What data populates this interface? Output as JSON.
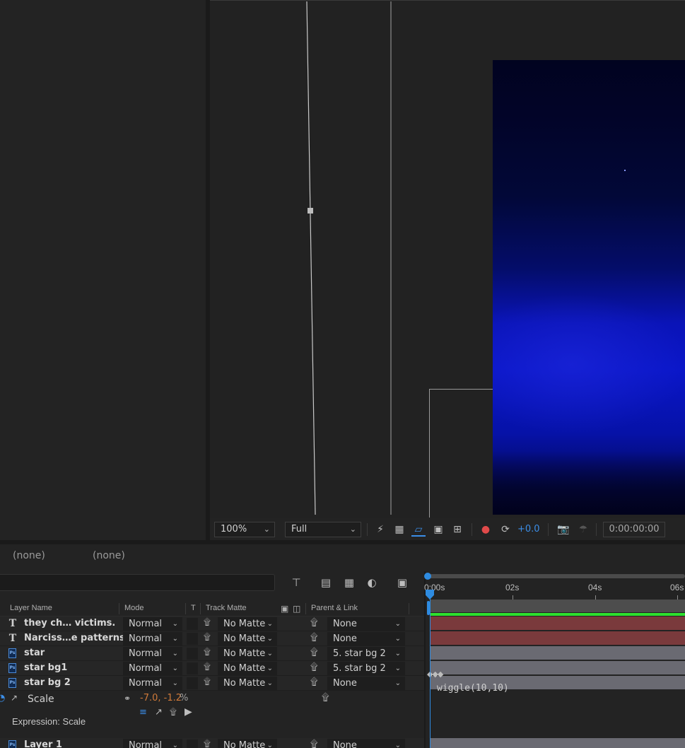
{
  "viewer": {
    "zoom": "100%",
    "resolution": "Full",
    "exposure": "+0.0",
    "timecode": "0:00:00:00",
    "icons": [
      "fast-preview-icon",
      "transparency-grid-icon",
      "mask-path-icon",
      "region-of-interest-icon",
      "safe-margins-icon",
      "color-channels-icon",
      "reset-exposure-icon",
      "snapshot-icon",
      "show-snapshot-icon"
    ]
  },
  "timeline": {
    "flowchart_labels": [
      "(none)",
      "(none)"
    ],
    "columns": {
      "layer_name": "Layer Name",
      "mode": "Mode",
      "t": "T",
      "track_matte": "Track Matte",
      "parent_link": "Parent & Link"
    },
    "layers": [
      {
        "type": "text",
        "name": "they ch… victims.",
        "mode": "Normal",
        "matte": "No Matte",
        "parent": "None",
        "color": "#7a3a3c"
      },
      {
        "type": "text",
        "name": "Narciss…e patterns;",
        "mode": "Normal",
        "matte": "No Matte",
        "parent": "None",
        "color": "#7a3a3c"
      },
      {
        "type": "ps",
        "name": "star",
        "mode": "Normal",
        "matte": "No Matte",
        "parent": "5. star bg 2",
        "color": "#6a6a72"
      },
      {
        "type": "ps",
        "name": "star bg1",
        "mode": "Normal",
        "matte": "No Matte",
        "parent": "5. star bg 2",
        "color": "#6a6a72"
      },
      {
        "type": "ps",
        "name": "star bg 2",
        "mode": "Normal",
        "matte": "No Matte",
        "parent": "None",
        "color": "#6a6a72"
      }
    ],
    "scale": {
      "label": "Scale",
      "value": "-7.0, -1.2",
      "unit": "%",
      "value_color": "#d07a3a"
    },
    "expression": {
      "label": "Expression: Scale",
      "code": "wiggle(10,10)"
    },
    "layer_partial": {
      "type": "ps",
      "name": "Layer 1",
      "mode": "Normal",
      "matte": "No Matte",
      "parent": "None"
    },
    "time_ruler": [
      "0:00s",
      "02s",
      "04s",
      "06s"
    ]
  }
}
